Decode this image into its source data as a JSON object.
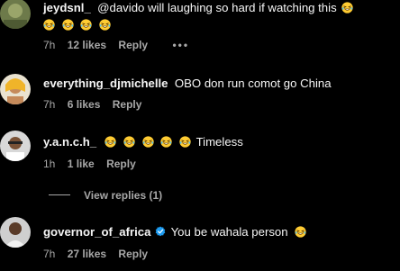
{
  "comments": [
    {
      "username": "jeydsnl_",
      "text": "@davido will laughing so hard if watching this",
      "emoji_line2": 4,
      "time": "7h",
      "likes": "12 likes",
      "reply": "Reply",
      "more": "•••"
    },
    {
      "username": "everything_djmichelle",
      "text": "OBO don run comot go China",
      "time": "7h",
      "likes": "6 likes",
      "reply": "Reply"
    },
    {
      "username": "y.a.n.c.h_",
      "text": "Timeless",
      "time": "1h",
      "likes": "1 like",
      "reply": "Reply"
    },
    {
      "username": "governor_of_africa",
      "text": "You be wahala person",
      "time": "7h",
      "likes": "27 likes",
      "reply": "Reply"
    }
  ],
  "view_replies": "View replies (1)",
  "icons": {
    "emoji": "laughing-emoji-icon",
    "verified": "verified-badge-icon",
    "more": "more-options-icon"
  },
  "colors": {
    "background": "#000000",
    "text": "#f5f5f5",
    "secondary": "#a8a8a8",
    "verified": "#1d9bf0",
    "emoji": "#ffcc33"
  }
}
